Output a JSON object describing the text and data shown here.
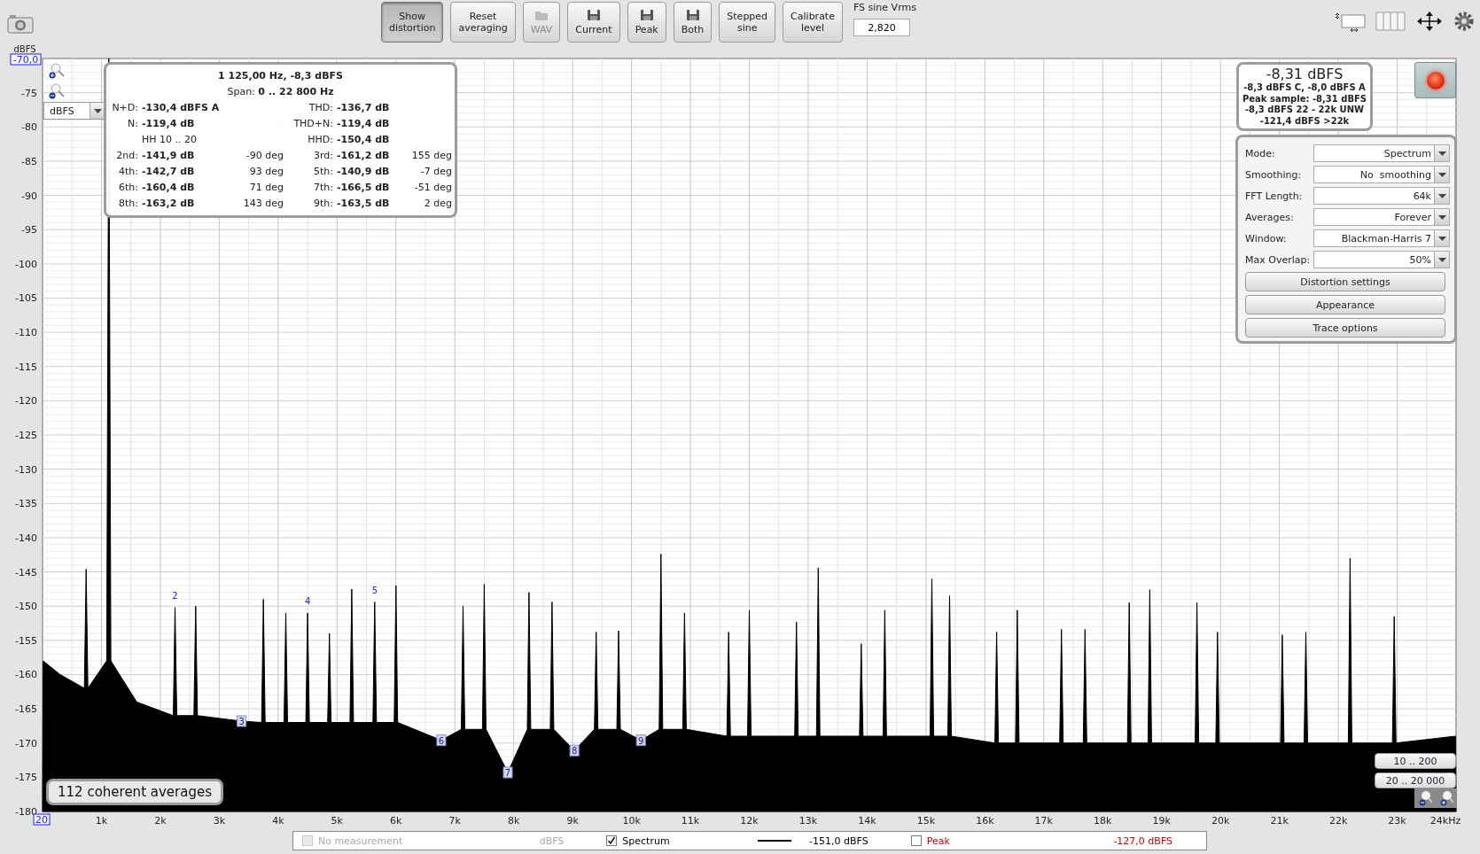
{
  "toolbar": {
    "buttons": [
      {
        "label": "Show distortion",
        "kind": "text",
        "pressed": true,
        "disabled": false
      },
      {
        "label": "Reset averaging",
        "kind": "text",
        "pressed": false,
        "disabled": false
      },
      {
        "label": "WAV",
        "kind": "folder",
        "pressed": false,
        "disabled": true
      },
      {
        "label": "Current",
        "kind": "disk",
        "pressed": false,
        "disabled": false
      },
      {
        "label": "Peak",
        "kind": "disk",
        "pressed": false,
        "disabled": false
      },
      {
        "label": "Both",
        "kind": "disk",
        "pressed": false,
        "disabled": false
      },
      {
        "label": "Stepped sine",
        "kind": "text",
        "pressed": false,
        "disabled": false
      },
      {
        "label": "Calibrate level",
        "kind": "text",
        "pressed": false,
        "disabled": false
      }
    ],
    "fs_label": "FS sine Vrms",
    "fs_value": "2,820"
  },
  "axis_fields": {
    "y_max": "-70,0",
    "x_min": "20"
  },
  "unit_dropdown": "dBFS",
  "distortion": {
    "title": "1 125,00 Hz, -8,3 dBFS",
    "span": "Span: **0 .. 22 800 Hz**",
    "rows": [
      {
        "cells": [
          {
            "kind": "measure",
            "label": "N+D:",
            "value": "-130,4 dBFS A"
          },
          {
            "kind": "empty"
          },
          {
            "kind": "measure",
            "label": "THD:",
            "value": "-136,7 dB"
          },
          {
            "kind": "empty"
          }
        ]
      },
      {
        "cells": [
          {
            "kind": "measure",
            "label": "N:",
            "value": "-119,4 dB"
          },
          {
            "kind": "empty"
          },
          {
            "kind": "measure",
            "label": "THD+N:",
            "value": "-119,4 dB"
          },
          {
            "kind": "empty"
          }
        ]
      },
      {
        "cells": [
          {
            "kind": "note",
            "text": "HH 10 .. 20"
          },
          {
            "kind": "empty"
          },
          {
            "kind": "measure",
            "label": "HHD:",
            "value": "-150,4 dB"
          },
          {
            "kind": "empty"
          }
        ]
      },
      {
        "cells": [
          {
            "kind": "measure",
            "label": "2nd:",
            "value": "-141,9 dB"
          },
          {
            "kind": "phase",
            "text": "-90 deg"
          },
          {
            "kind": "measure",
            "label": "3rd:",
            "value": "-161,2 dB"
          },
          {
            "kind": "phase",
            "text": "155 deg"
          }
        ]
      },
      {
        "cells": [
          {
            "kind": "measure",
            "label": "4th:",
            "value": "-142,7 dB"
          },
          {
            "kind": "phase",
            "text": "93 deg"
          },
          {
            "kind": "measure",
            "label": "5th:",
            "value": "-140,9 dB"
          },
          {
            "kind": "phase",
            "text": "-7 deg"
          }
        ]
      },
      {
        "cells": [
          {
            "kind": "measure",
            "label": "6th:",
            "value": "-160,4 dB"
          },
          {
            "kind": "phase",
            "text": "71 deg"
          },
          {
            "kind": "measure",
            "label": "7th:",
            "value": "-166,5 dB"
          },
          {
            "kind": "phase",
            "text": "-51 deg"
          }
        ]
      },
      {
        "cells": [
          {
            "kind": "measure",
            "label": "8th:",
            "value": "-163,2 dB"
          },
          {
            "kind": "phase",
            "text": "143 deg"
          },
          {
            "kind": "measure",
            "label": "9th:",
            "value": "-163,5 dB"
          },
          {
            "kind": "phase",
            "text": "2 deg"
          }
        ]
      }
    ]
  },
  "summary": {
    "level": "-8,31 dBFS",
    "lines": [
      "-8,3 dBFS C, -8,0 dBFS A",
      "Peak sample: -8,31 dBFS",
      "-8,3 dBFS 22 - 22k UNW",
      "-121,4 dBFS >22k"
    ]
  },
  "recording": true,
  "settings": {
    "rows": [
      {
        "label": "Mode:",
        "value": "Spectrum"
      },
      {
        "label": "Smoothing:",
        "value": "No  smoothing"
      },
      {
        "label": "FFT Length:",
        "value": "64k"
      },
      {
        "label": "Averages:",
        "value": "Forever"
      },
      {
        "label": "Window:",
        "value": "Blackman-Harris 7"
      },
      {
        "label": "Max Overlap:",
        "value": "50%"
      }
    ],
    "buttons": [
      "Distortion settings",
      "Appearance",
      "Trace options"
    ]
  },
  "averages_badge": "112 coherent averages",
  "range_buttons": [
    "10 .. 200",
    "20 .. 20 000"
  ],
  "chart_data": {
    "type": "area",
    "ylabel": "dBFS",
    "xlim": [
      0,
      24
    ],
    "ylim": [
      -180,
      -70
    ],
    "grid": true,
    "xticks": [
      {
        "value": 1,
        "label": "1k"
      },
      {
        "value": 2,
        "label": "2k"
      },
      {
        "value": 3,
        "label": "3k"
      },
      {
        "value": 4,
        "label": "4k"
      },
      {
        "value": 5,
        "label": "5k"
      },
      {
        "value": 6,
        "label": "6k"
      },
      {
        "value": 7,
        "label": "7k"
      },
      {
        "value": 8,
        "label": "8k"
      },
      {
        "value": 9,
        "label": "9k"
      },
      {
        "value": 10,
        "label": "10k"
      },
      {
        "value": 11,
        "label": "11k"
      },
      {
        "value": 12,
        "label": "12k"
      },
      {
        "value": 13,
        "label": "13k"
      },
      {
        "value": 14,
        "label": "14k"
      },
      {
        "value": 15,
        "label": "15k"
      },
      {
        "value": 16,
        "label": "16k"
      },
      {
        "value": 17,
        "label": "17k"
      },
      {
        "value": 18,
        "label": "18k"
      },
      {
        "value": 19,
        "label": "19k"
      },
      {
        "value": 20,
        "label": "20k"
      },
      {
        "value": 21,
        "label": "21k"
      },
      {
        "value": 22,
        "label": "22k"
      },
      {
        "value": 23,
        "label": "23k"
      },
      {
        "value": 24,
        "label": "24kHz"
      }
    ],
    "yticks": [
      -75,
      -80,
      -85,
      -90,
      -95,
      -100,
      -105,
      -110,
      -115,
      -120,
      -125,
      -130,
      -135,
      -140,
      -145,
      -150,
      -155,
      -160,
      -165,
      -170,
      -175,
      -180
    ],
    "x": [
      0,
      0.01,
      0.3,
      0.71,
      0.74,
      0.77,
      1.09,
      1.125,
      1.16,
      1.6,
      2.22,
      2.25,
      2.28,
      2.57,
      2.6,
      2.63,
      3.38,
      3.72,
      3.75,
      3.78,
      4.1,
      4.13,
      4.16,
      4.47,
      4.5,
      4.53,
      4.84,
      4.87,
      4.9,
      5.22,
      5.25,
      5.28,
      5.61,
      5.64,
      5.67,
      5.97,
      6,
      6.03,
      6.77,
      7.11,
      7.14,
      7.17,
      7.47,
      7.5,
      7.53,
      7.9,
      8.23,
      8.26,
      8.29,
      8.62,
      8.65,
      8.68,
      9.03,
      9.37,
      9.4,
      9.43,
      9.75,
      9.78,
      9.81,
      10.16,
      10.47,
      10.5,
      10.53,
      10.87,
      10.9,
      10.93,
      11.62,
      11.65,
      11.68,
      11.97,
      12,
      12.03,
      12.77,
      12.8,
      12.83,
      13.14,
      13.17,
      13.2,
      13.87,
      13.9,
      13.93,
      14.27,
      14.3,
      14.33,
      15.07,
      15.1,
      15.13,
      15.37,
      15.4,
      15.43,
      16.17,
      16.2,
      16.23,
      16.52,
      16.55,
      16.58,
      17.27,
      17.3,
      17.33,
      17.67,
      17.7,
      17.73,
      18.42,
      18.45,
      18.48,
      18.77,
      18.8,
      18.83,
      19.57,
      19.6,
      19.63,
      19.92,
      19.95,
      19.98,
      21.02,
      21.05,
      21.08,
      21.42,
      21.45,
      21.48,
      22.17,
      22.2,
      22.23,
      22.92,
      22.95,
      22.98,
      23.99,
      24
    ],
    "series": [
      {
        "name": "Spectrum",
        "color": "#000000",
        "values": [
          -180,
          -158,
          -160,
          -162,
          -144.6,
          -162,
          -158,
          -70,
          -158,
          -164,
          -166,
          -150.2,
          -166,
          -166,
          -150,
          -166,
          -166.8,
          -167,
          -149,
          -167,
          -167,
          -151,
          -167,
          -167,
          -151,
          -167,
          -167,
          -154,
          -167,
          -167,
          -147.5,
          -167,
          -167,
          -149.4,
          -167,
          -167,
          -147,
          -167,
          -169.6,
          -168,
          -150,
          -168,
          -168,
          -146.8,
          -168,
          -174.3,
          -168,
          -148,
          -168,
          -168,
          -149.4,
          -168,
          -171.1,
          -168,
          -153.8,
          -168,
          -168,
          -153.6,
          -168,
          -169.6,
          -168,
          -142.4,
          -168,
          -168,
          -151,
          -168,
          -169,
          -153.8,
          -169,
          -169,
          -150.6,
          -169,
          -169,
          -152.3,
          -169,
          -169,
          -144.4,
          -169,
          -169,
          -155.5,
          -169,
          -169,
          -150.6,
          -169,
          -169,
          -146,
          -169,
          -169,
          -148.5,
          -169,
          -170,
          -153.8,
          -170,
          -170,
          -150.6,
          -170,
          -170,
          -153.4,
          -170,
          -170,
          -153.4,
          -170,
          -170,
          -149.5,
          -170,
          -170,
          -147.6,
          -170,
          -170,
          -149.5,
          -170,
          -170,
          -153.8,
          -170,
          -170,
          -154.2,
          -170,
          -170,
          -153.8,
          -170,
          -170,
          -143,
          -170,
          -170,
          -151.5,
          -170,
          -169,
          -180
        ]
      }
    ],
    "annotations": [
      {
        "text": "2",
        "x": 2.25,
        "y": -150.2
      },
      {
        "text": "3",
        "x": 3.38,
        "y": -166.8
      },
      {
        "text": "4",
        "x": 4.5,
        "y": -151
      },
      {
        "text": "5",
        "x": 5.64,
        "y": -149.4
      },
      {
        "text": "6",
        "x": 6.77,
        "y": -169.6
      },
      {
        "text": "7",
        "x": 7.9,
        "y": -174.3
      },
      {
        "text": "8",
        "x": 9.03,
        "y": -171.1
      },
      {
        "text": "9",
        "x": 10.16,
        "y": -169.6
      }
    ]
  },
  "legend": [
    {
      "label": "No measurement",
      "value": "dBFS",
      "checked": false,
      "disabled": true,
      "color": "#aaaaaa"
    },
    {
      "value": "-151,0 dBFS",
      "checked": true,
      "disabled": false,
      "color": "#000000"
    },
    {
      "label": "Peak",
      "value": "-127,0 dBFS",
      "checked": false,
      "disabled": false,
      "color": "#cc0000"
    }
  ]
}
